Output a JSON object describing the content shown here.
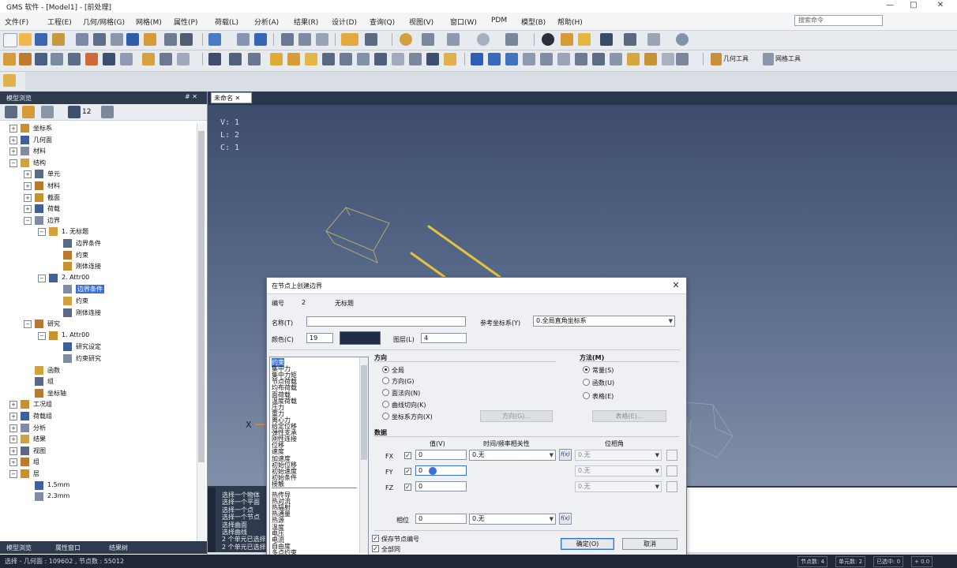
{
  "window": {
    "title": "GMS 软件 - [Model1] - [前处理]",
    "controls": [
      "—",
      "□",
      "✕"
    ]
  },
  "menubar": {
    "items": [
      "文件(F)",
      "工程(E)",
      "几何/网格(G)",
      "网格(M)",
      "属性(P)",
      "荷载(L)",
      "分析(A)",
      "结果(R)",
      "设计(D)",
      "查询(Q)",
      "视图(V)",
      "窗口(W)",
      "PDM",
      "模型(B)",
      "帮助(H)"
    ],
    "search_placeholder": "搜索命令"
  },
  "toolbar3": {
    "btn1": "几何工具",
    "btn2": "网格工具"
  },
  "left_panel": {
    "title": "模型浏览",
    "pin": "# ✕",
    "tool_number": "12",
    "tree": [
      {
        "label": "坐标系",
        "level": 0,
        "exp": "+"
      },
      {
        "label": "几何面",
        "level": 0,
        "exp": "+"
      },
      {
        "label": "材料",
        "level": 0,
        "exp": "+"
      },
      {
        "label": "结构",
        "level": 0,
        "exp": "−"
      },
      {
        "label": "单元",
        "level": 1,
        "exp": "+"
      },
      {
        "label": "材料",
        "level": 1,
        "exp": "+"
      },
      {
        "label": "截面",
        "level": 1,
        "exp": "+"
      },
      {
        "label": "荷载",
        "level": 1,
        "exp": "+"
      },
      {
        "label": "边界",
        "level": 1,
        "exp": "−"
      },
      {
        "label": "1. 无标题",
        "level": 2,
        "exp": "−"
      },
      {
        "label": "边界条件",
        "level": 3,
        "exp": ""
      },
      {
        "label": "约束",
        "level": 3,
        "exp": ""
      },
      {
        "label": "刚体连接",
        "level": 3,
        "exp": ""
      },
      {
        "label": "2. Attr00",
        "level": 2,
        "exp": "−"
      },
      {
        "label": "边界条件",
        "level": 3,
        "exp": "",
        "selected": true
      },
      {
        "label": "约束",
        "level": 3,
        "exp": ""
      },
      {
        "label": "刚体连接",
        "level": 3,
        "exp": ""
      },
      {
        "label": "研究",
        "level": 1,
        "exp": "−"
      },
      {
        "label": "1. Attr00",
        "level": 2,
        "exp": "−"
      },
      {
        "label": "研究设定",
        "level": 3,
        "exp": ""
      },
      {
        "label": "约束研究",
        "level": 3,
        "exp": ""
      },
      {
        "label": "函数",
        "level": 1,
        "exp": ""
      },
      {
        "label": "组",
        "level": 1,
        "exp": ""
      },
      {
        "label": "坐标轴",
        "level": 1,
        "exp": ""
      },
      {
        "label": "工况组",
        "level": 0,
        "exp": "+"
      },
      {
        "label": "荷载组",
        "level": 0,
        "exp": "+"
      },
      {
        "label": "分析",
        "level": 0,
        "exp": "+"
      },
      {
        "label": "结果",
        "level": 0,
        "exp": "+"
      },
      {
        "label": "视图",
        "level": 0,
        "exp": "+"
      },
      {
        "label": "组",
        "level": 0,
        "exp": "+"
      },
      {
        "label": "层",
        "level": 0,
        "exp": "−"
      },
      {
        "label": "1.5mm",
        "level": 1,
        "exp": ""
      },
      {
        "label": "2.3mm",
        "level": 1,
        "exp": ""
      }
    ],
    "bottom_tabs": [
      "模型浏览",
      "属性窗口",
      "结果树"
    ]
  },
  "viewport": {
    "tab": "未命名",
    "stats": [
      "V: 1",
      "L: 2",
      "C: 1"
    ],
    "axis_label": "X"
  },
  "message_window": {
    "lines": [
      "选择一个物体",
      "选择一个平面",
      "选择一个点",
      "选择一个节点",
      "选择曲面",
      "选择曲线",
      "2 个单元已选择",
      "2 个单元已选择"
    ]
  },
  "statusbar": {
    "left": "选择 - 几何面 : 109602 , 节点数 : 55012",
    "boxes": [
      "节点数: 4",
      "单元数: 2",
      "已选中: 0",
      "+ 0.0"
    ]
  },
  "dialog": {
    "title": "在节点上创建边界",
    "no_label": "编号",
    "no_value": "2",
    "no_name": "无标题",
    "name_label": "名称(T)",
    "name_value": "",
    "ref_cs_label": "参考坐标系(Y)",
    "ref_cs_value": "0.全局直角坐标系",
    "color_label": "颜色(C)",
    "color_value": "19",
    "layer_label": "图层(L)",
    "layer_value": "4",
    "list_items": [
      "约束",
      "集中力",
      "集中力矩",
      "节点荷载",
      "均布荷载",
      "面荷载",
      "温度荷载",
      "压力",
      "重力",
      "离心力",
      "给定位移",
      "弹性支承",
      "刚性连接",
      "位移",
      "速度",
      "加速度",
      "初始位移",
      "初始速度",
      "初始条件",
      "接触",
      "热传导",
      "热对流",
      "热辐射",
      "热通量",
      "热源",
      "温度",
      "电压",
      "电流",
      "自由度",
      "多点约束"
    ],
    "direction_title": "方向",
    "directions": [
      "全局",
      "方向(G)",
      "面法向(N)",
      "曲线切向(K)",
      "坐标系方向(X)"
    ],
    "direction_btn": "方向(G)...",
    "method_title": "方法(M)",
    "methods": [
      "常量(S)",
      "函数(U)",
      "表格(E)"
    ],
    "method_btn": "表格(E)...",
    "data_title": "数据",
    "col_value": "值(V)",
    "col_time": "时间/频率相关性",
    "col_phase": "位相角",
    "rows": [
      {
        "label": "FX",
        "value": "0",
        "time": "0.无",
        "phase": "0.无"
      },
      {
        "label": "FY",
        "value": "0",
        "time": "",
        "phase": "0.无"
      },
      {
        "label": "FZ",
        "value": "0",
        "time": "",
        "phase": "0.无"
      }
    ],
    "phase_label": "相位",
    "phase_value": "0",
    "phase_time": "0.无",
    "fx_btn": "f(x)",
    "check1": "保存节点编号",
    "check2": "全部同",
    "ok": "确定(O)",
    "cancel": "取消"
  }
}
